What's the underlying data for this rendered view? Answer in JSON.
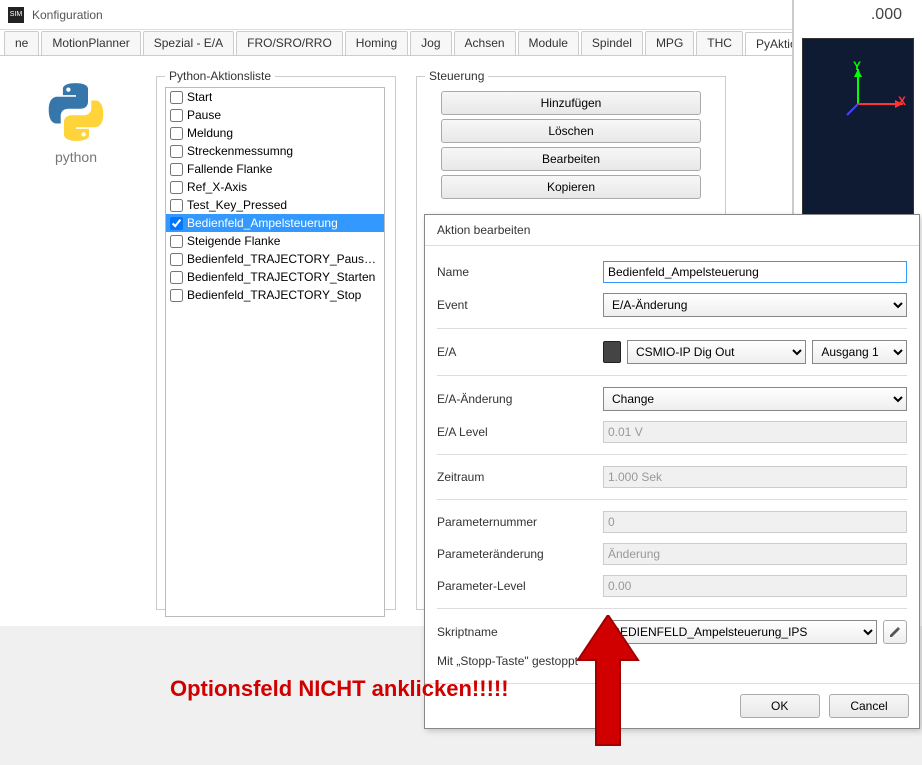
{
  "window": {
    "title": "Konfiguration",
    "help": "?",
    "close": "✕"
  },
  "tabs": [
    "ne",
    "MotionPlanner",
    "Spezial - E/A",
    "FRO/SRO/RRO",
    "Homing",
    "Jog",
    "Achsen",
    "Module",
    "Spindel",
    "MPG",
    "THC",
    "PyAktionen"
  ],
  "active_tab": "PyAktionen",
  "logo_caption": "python",
  "list_title": "Python-Aktionsliste",
  "actions": [
    {
      "label": "Start",
      "checked": false
    },
    {
      "label": "Pause",
      "checked": false
    },
    {
      "label": "Meldung",
      "checked": false
    },
    {
      "label": "Streckenmessumng",
      "checked": false
    },
    {
      "label": "Fallende Flanke",
      "checked": false
    },
    {
      "label": "Ref_X-Axis",
      "checked": false
    },
    {
      "label": "Test_Key_Pressed",
      "checked": false
    },
    {
      "label": "Bedienfeld_Ampelsteuerung",
      "checked": true,
      "selected": true
    },
    {
      "label": "Steigende Flanke",
      "checked": false
    },
    {
      "label": "Bedienfeld_TRAJECTORY_Pause_EIN",
      "checked": false
    },
    {
      "label": "Bedienfeld_TRAJECTORY_Starten",
      "checked": false
    },
    {
      "label": "Bedienfeld_TRAJECTORY_Stop",
      "checked": false
    }
  ],
  "steuerung": {
    "title": "Steuerung",
    "buttons": [
      "Hinzufügen",
      "Löschen",
      "Bearbeiten",
      "Kopieren"
    ]
  },
  "edit": {
    "title": "Aktion bearbeiten",
    "labels": {
      "name": "Name",
      "event": "Event",
      "ea": "E/A",
      "ea_change": "E/A-Änderung",
      "ea_level": "E/A Level",
      "period": "Zeitraum",
      "param_num": "Parameternummer",
      "param_change": "Parameteränderung",
      "param_level": "Parameter-Level",
      "script": "Skriptname",
      "stop": "Mit „Stopp-Taste\" gestoppt"
    },
    "values": {
      "name": "Bedienfeld_Ampelsteuerung",
      "event": "E/A-Änderung",
      "ea_device": "CSMIO-IP  Dig Out",
      "ea_port": "Ausgang 1",
      "ea_change": "Change",
      "ea_level": "0.01 V",
      "period": "1.000 Sek",
      "param_num": "0",
      "param_change": "Änderung",
      "param_level": "0.00",
      "script": "BEDIENFELD_Ampelsteuerung_IPS"
    },
    "ok": "OK",
    "cancel": "Cancel"
  },
  "preview": {
    "dro": ".000",
    "y": "Y",
    "x": "X"
  },
  "annotation": "Optionsfeld NICHT anklicken!!!!!"
}
